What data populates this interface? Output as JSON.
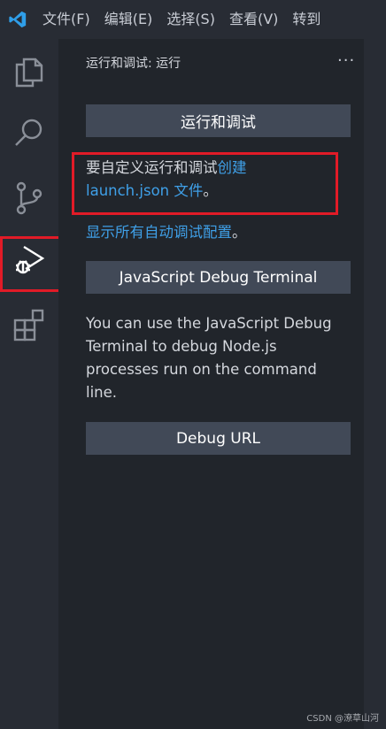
{
  "menu": {
    "file": "文件(F)",
    "edit": "编辑(E)",
    "selection": "选择(S)",
    "view": "查看(V)",
    "go": "转到"
  },
  "sidebar": {
    "title": "运行和调试: 运行",
    "run_debug_button": "运行和调试",
    "customize_text": "要自定义运行和调试",
    "create_link": "创建",
    "launch_link": "launch.json 文件",
    "period": "。",
    "show_all_link": "显示所有自动调试配置",
    "show_all_period": "。",
    "js_terminal_button": "JavaScript Debug Terminal",
    "js_terminal_desc": "You can use the JavaScript Debug Terminal to debug Node.js processes run on the command line.",
    "debug_url_button": "Debug URL"
  },
  "watermark": "CSDN @潦草山河",
  "colors": {
    "accent_link": "#3fa0e8",
    "highlight_red": "#e11b27",
    "button_bg": "#414957"
  }
}
